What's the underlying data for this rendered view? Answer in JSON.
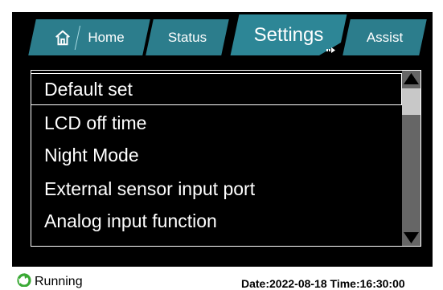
{
  "tabs": [
    {
      "label": "Home",
      "icon": "home-icon"
    },
    {
      "label": "Status"
    },
    {
      "label": "Settings",
      "active": true
    },
    {
      "label": "Assist"
    }
  ],
  "menu": {
    "items": [
      {
        "label": "Default set",
        "selected": true
      },
      {
        "label": "LCD off time"
      },
      {
        "label": "Night Mode"
      },
      {
        "label": "External sensor input port"
      },
      {
        "label": "Analog input function"
      }
    ]
  },
  "status": {
    "label": "Running",
    "icon": "running-icon"
  },
  "datetime": {
    "date_label": "Date:",
    "date": "2022-08-18",
    "time_label": "Time:",
    "time": "16:30:00"
  },
  "colors": {
    "tab": "#2c7d8c",
    "active_tab": "#2d8696",
    "background": "#000000",
    "status_icon": "#3aa935"
  }
}
